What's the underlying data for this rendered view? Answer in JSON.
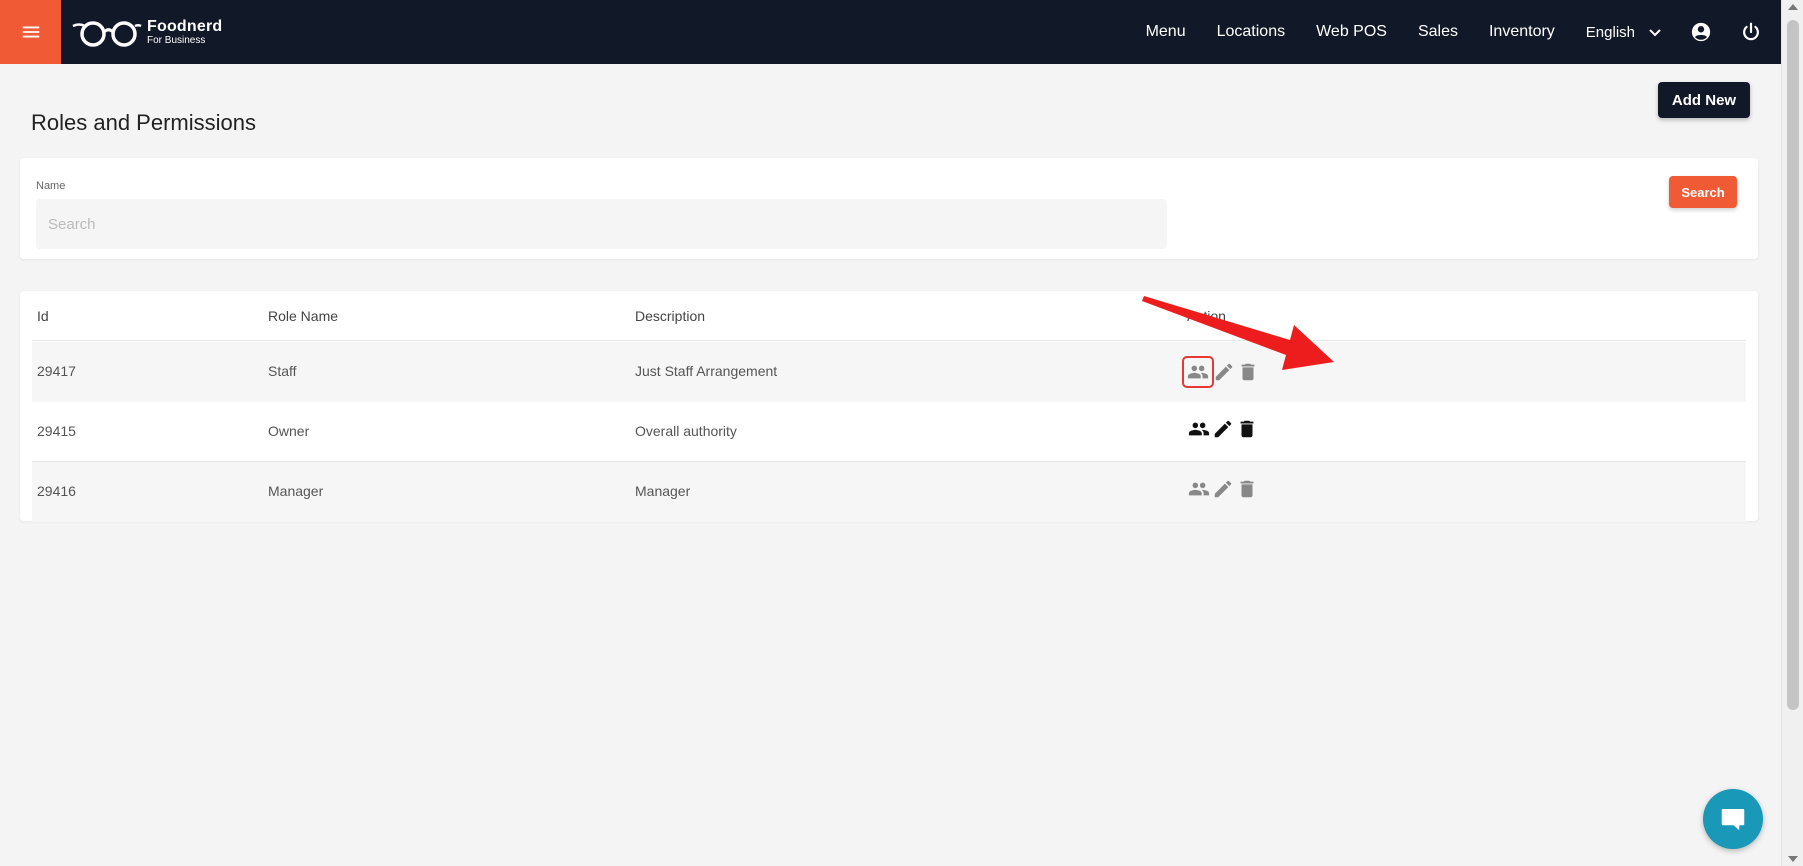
{
  "topbar": {
    "brand_name": "Foodnerd",
    "brand_sub": "For Business",
    "nav": [
      "Menu",
      "Locations",
      "Web POS",
      "Sales",
      "Inventory"
    ],
    "language": "English"
  },
  "page": {
    "title": "Roles and Permissions",
    "add_label": "Add New"
  },
  "search": {
    "field_label": "Name",
    "placeholder": "Search",
    "value": "",
    "button_label": "Search"
  },
  "table": {
    "headers": {
      "id": "Id",
      "role_name": "Role Name",
      "description": "Description",
      "action": "Action"
    },
    "rows": [
      {
        "id": "29417",
        "role_name": "Staff",
        "description": "Just Staff Arrangement"
      },
      {
        "id": "29415",
        "role_name": "Owner",
        "description": "Overall authority"
      },
      {
        "id": "29416",
        "role_name": "Manager",
        "description": "Manager"
      }
    ]
  },
  "icons": {
    "menu": "menu-icon",
    "logo": "glasses-logo",
    "language_toggle": "chevron-down-icon",
    "account": "account-circle-icon",
    "power": "power-icon",
    "permissions": "people-icon",
    "edit": "pencil-icon",
    "delete": "trash-icon",
    "chat": "chat-bubble-icon"
  },
  "colors": {
    "topbar": "#111827",
    "accent": "#f05a35",
    "annotation": "#e53935",
    "chat": "#1a98b8"
  }
}
